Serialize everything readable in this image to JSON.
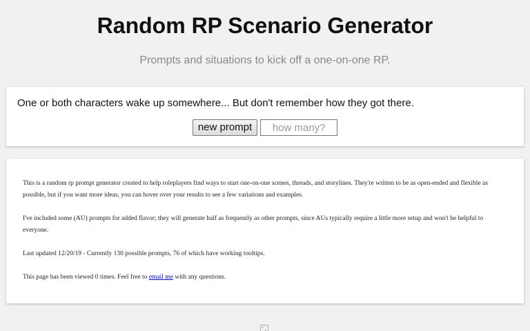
{
  "header": {
    "title": "Random RP Scenario Generator",
    "subtitle": "Prompts and situations to kick off a one-on-one RP."
  },
  "prompt": {
    "text": "One or both characters wake up somewhere... But don't remember how they got there.",
    "new_prompt_label": "new prompt",
    "count_placeholder": "how many?",
    "count_value": ""
  },
  "info": {
    "paragraph1": "This is a random rp prompt generator created to help roleplayers find ways to start one-on-one scenes, threads, and storylines. They're written to be as open-ended and flexible as possible, but if you want more ideas, you can hover over your results to see a few variations and examples.",
    "paragraph2": "I've included some (AU) prompts for added flavor; they will generate half as frequently as other prompts, since AUs typically require a little more setup and won't be helpful to everyone.",
    "paragraph3": "Last updated 12/20/19 - Currently 130 possible prompts, 76 of which have working tooltips.",
    "views_prefix": "This page has been viewed 0 times. Feel free to ",
    "email_link": "email me",
    "views_suffix": " with any questions."
  },
  "footer": {
    "icon": "dice-icon"
  }
}
